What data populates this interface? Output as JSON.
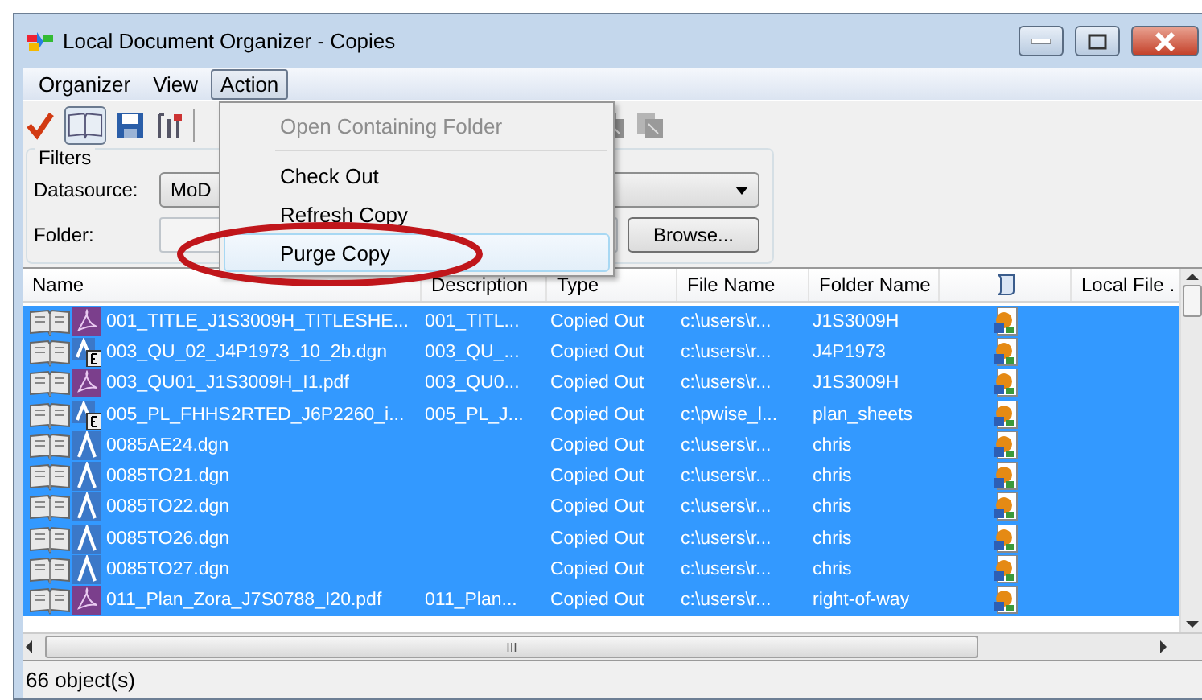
{
  "window": {
    "title": "Local Document Organizer - Copies"
  },
  "menu": [
    {
      "label": "Organizer",
      "selected": false
    },
    {
      "label": "View",
      "selected": false
    },
    {
      "label": "Action",
      "selected": true
    }
  ],
  "action_menu": [
    {
      "label": "Open Containing Folder",
      "disabled": true,
      "selected": false,
      "separator_after": true
    },
    {
      "label": "Check Out",
      "disabled": false,
      "selected": false,
      "separator_after": false
    },
    {
      "label": "Refresh Copy",
      "disabled": false,
      "selected": false,
      "separator_after": false
    },
    {
      "label": "Purge Copy",
      "disabled": false,
      "selected": true,
      "separator_after": false
    }
  ],
  "filters": {
    "title": "Filters",
    "datasource_label": "Datasource:",
    "datasource_value": "MoD",
    "folder_label": "Folder:",
    "browse": "Browse..."
  },
  "table": {
    "columns": [
      "Name",
      "Description",
      "Type",
      "File Name",
      "Folder Name",
      "Local File ."
    ],
    "rows": [
      {
        "kind": "pdf",
        "selected": true,
        "cells": [
          "001_TITLE_J1S3009H_TITLESHE...",
          "001_TITL...",
          "Copied Out",
          "c:\\users\\r...",
          "J1S3009H"
        ]
      },
      {
        "kind": "dgn_ref",
        "selected": true,
        "cells": [
          "003_QU_02_J4P1973_10_2b.dgn",
          "003_QU_...",
          "Copied Out",
          "c:\\users\\r...",
          "J4P1973"
        ]
      },
      {
        "kind": "pdf",
        "selected": true,
        "cells": [
          "003_QU01_J1S3009H_I1.pdf",
          "003_QU0...",
          "Copied Out",
          "c:\\users\\r...",
          "J1S3009H"
        ]
      },
      {
        "kind": "dgn_ref",
        "selected": true,
        "cells": [
          "005_PL_FHHS2RTED_J6P2260_i...",
          "005_PL_J...",
          "Copied Out",
          "c:\\pwise_l...",
          "plan_sheets"
        ]
      },
      {
        "kind": "dgn",
        "selected": true,
        "cells": [
          "0085AE24.dgn",
          "",
          "Copied Out",
          "c:\\users\\r...",
          "chris"
        ]
      },
      {
        "kind": "dgn",
        "selected": true,
        "cells": [
          "0085TO21.dgn",
          "",
          "Copied Out",
          "c:\\users\\r...",
          "chris"
        ]
      },
      {
        "kind": "dgn",
        "selected": true,
        "cells": [
          "0085TO22.dgn",
          "",
          "Copied Out",
          "c:\\users\\r...",
          "chris"
        ]
      },
      {
        "kind": "dgn",
        "selected": true,
        "cells": [
          "0085TO26.dgn",
          "",
          "Copied Out",
          "c:\\users\\r...",
          "chris"
        ]
      },
      {
        "kind": "dgn",
        "selected": true,
        "cells": [
          "0085TO27.dgn",
          "",
          "Copied Out",
          "c:\\users\\r...",
          "chris"
        ]
      },
      {
        "kind": "pdf",
        "selected": true,
        "cells": [
          "011_Plan_Zora_J7S0788_I20.pdf",
          "011_Plan...",
          "Copied Out",
          "c:\\users\\r...",
          "right-of-way"
        ]
      }
    ]
  },
  "scrollbar_grip": "III",
  "status_bar": "66 object(s)"
}
